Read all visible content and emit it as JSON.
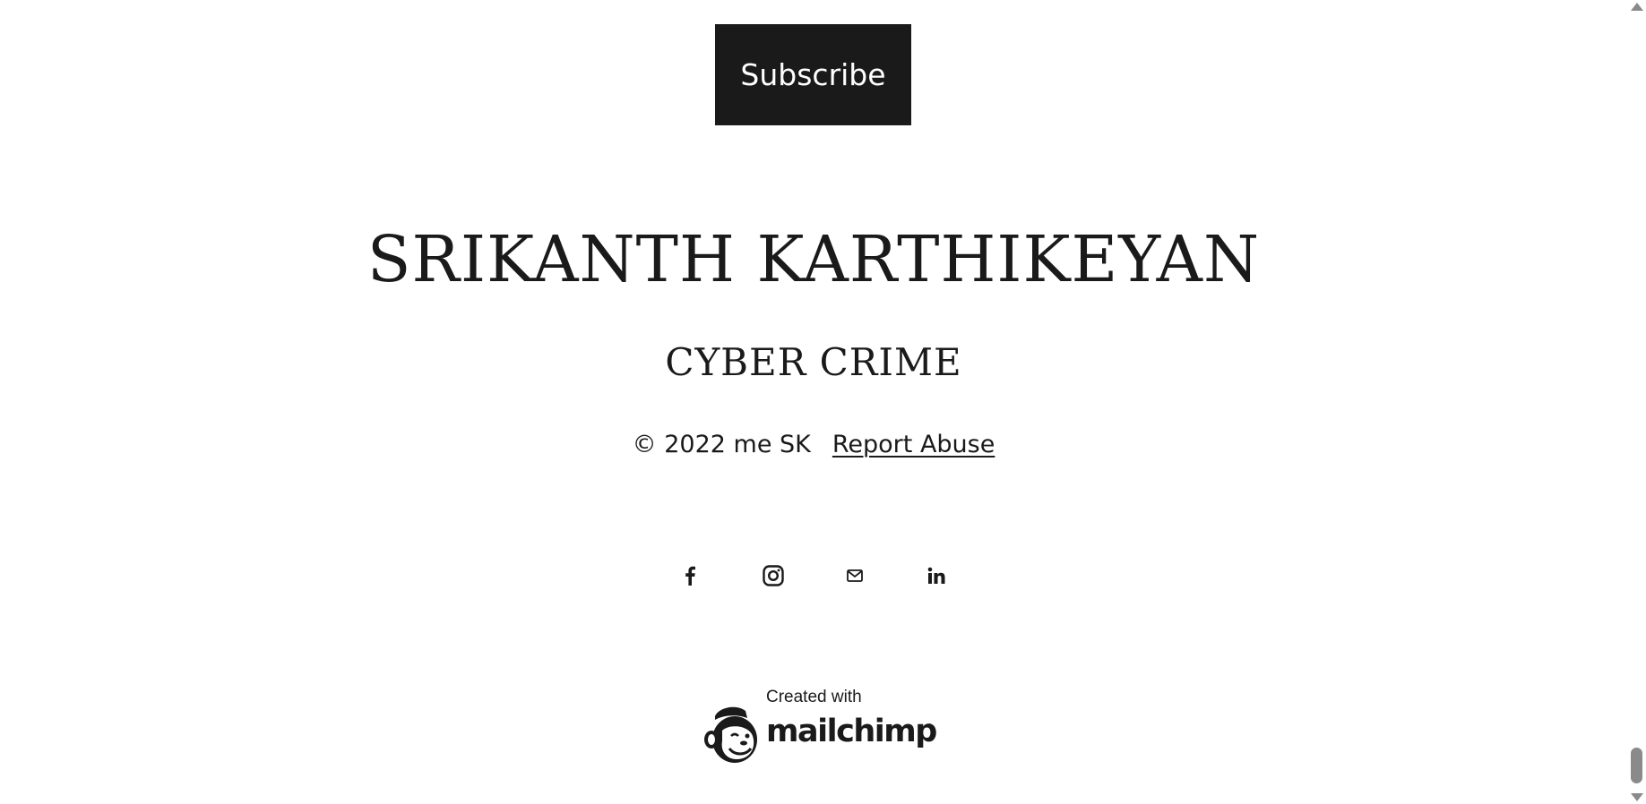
{
  "subscribe": {
    "label": "Subscribe"
  },
  "footer": {
    "site_name": "SRIKANTH KARTHIKEYAN",
    "tagline": "CYBER CRIME",
    "copyright": "© 2022 me SK",
    "report_abuse": "Report Abuse"
  },
  "social": {
    "icons": [
      "facebook-icon",
      "instagram-icon",
      "email-icon",
      "linkedin-icon"
    ]
  },
  "badge": {
    "created_with": "Created with",
    "brand": "mailchimp",
    "logo_icon": "mailchimp-freddie-icon"
  },
  "colors": {
    "button_bg": "#1a1a1a",
    "button_text": "#ffffff",
    "text": "#1a1a1a",
    "background": "#ffffff"
  }
}
